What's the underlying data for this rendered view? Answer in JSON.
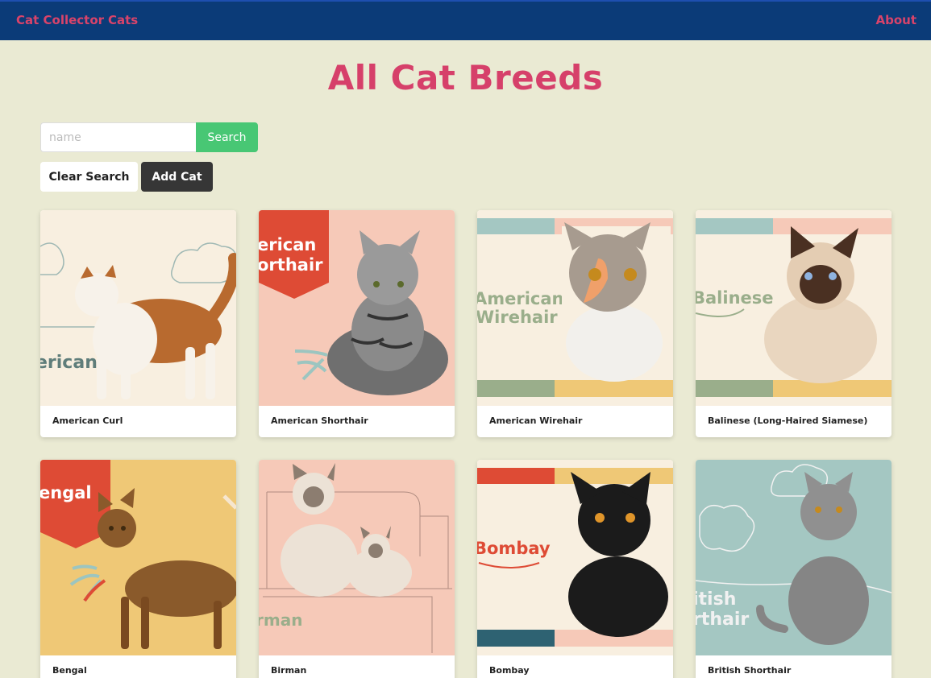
{
  "nav": {
    "brand": "Cat Collector",
    "cats": "Cats",
    "about": "About"
  },
  "page": {
    "title": "All Cat Breeds"
  },
  "search": {
    "placeholder": "name",
    "button": "Search",
    "clear": "Clear Search",
    "add": "Add Cat"
  },
  "breeds": [
    {
      "name": "American Curl",
      "image_text": "erican",
      "bg": "#f8efe0",
      "cat_color": "#b86a2f"
    },
    {
      "name": "American Shorthair",
      "image_text": "erican orthair",
      "bg": "#f6c9b8",
      "cat_color": "#6f6f6f"
    },
    {
      "name": "American Wirehair",
      "image_text": "American Wirehair",
      "bg": "#f8efe0",
      "cat_color": "#a79b8f"
    },
    {
      "name": "Balinese (Long-Haired Siamese)",
      "image_text": "Balinese",
      "bg": "#f8efe0",
      "cat_color": "#e9d6bf"
    },
    {
      "name": "Bengal",
      "image_text": "engal",
      "bg": "#efc876",
      "cat_color": "#8a5a2b"
    },
    {
      "name": "Birman",
      "image_text": "rman",
      "bg": "#f6c9b8",
      "cat_color": "#ece2d6"
    },
    {
      "name": "Bombay",
      "image_text": "Bombay",
      "bg": "#f8efe0",
      "cat_color": "#1b1b1b"
    },
    {
      "name": "British Shorthair",
      "image_text": "itish rthair",
      "bg": "#a4c7c2",
      "cat_color": "#858585"
    }
  ]
}
